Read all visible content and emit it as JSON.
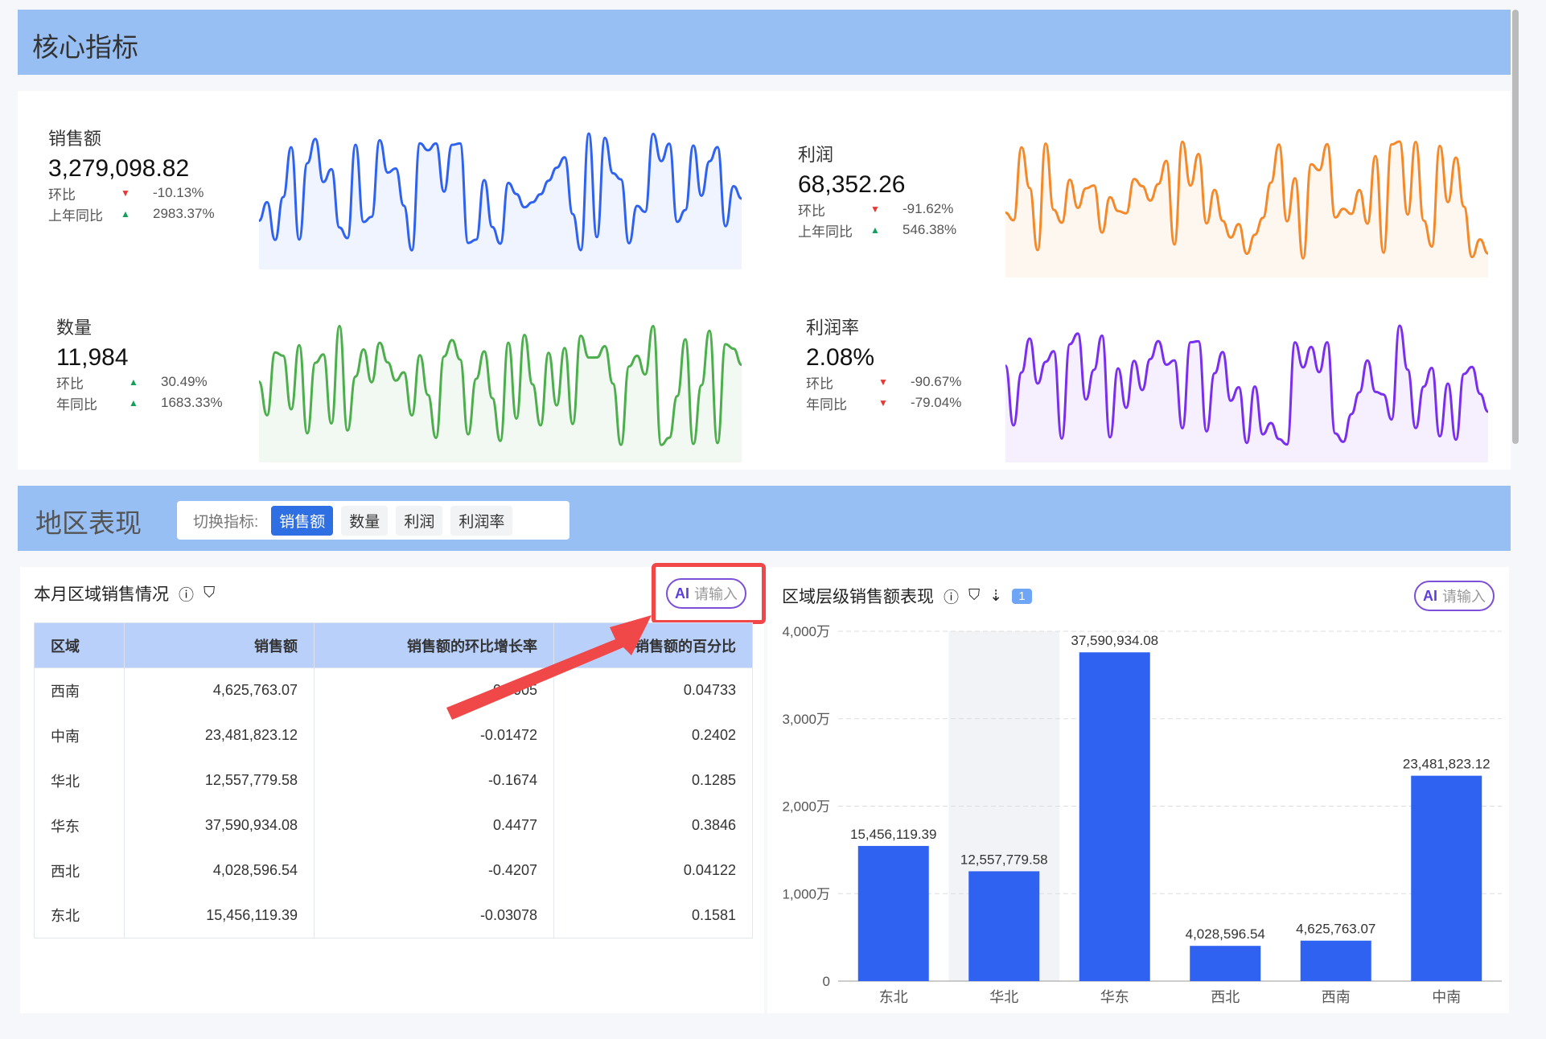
{
  "section1": {
    "title": "核心指标"
  },
  "kpis": [
    {
      "label": "销售额",
      "value": "3,279,098.82",
      "rows": [
        {
          "k": "环比",
          "dir": "down",
          "v": "-10.13%"
        },
        {
          "k": "上年同比",
          "dir": "up",
          "v": "2983.37%"
        }
      ],
      "color": "#2f62f0"
    },
    {
      "label": "利润",
      "value": "68,352.26",
      "rows": [
        {
          "k": "环比",
          "dir": "down",
          "v": "-91.62%"
        },
        {
          "k": "上年同比",
          "dir": "up",
          "v": "546.38%"
        }
      ],
      "color": "#f5892a"
    },
    {
      "label": "数量",
      "value": "11,984",
      "rows": [
        {
          "k": "环比",
          "dir": "up",
          "v": "30.49%"
        },
        {
          "k": "年同比",
          "dir": "up",
          "v": "1683.33%"
        }
      ],
      "color": "#4cae4c"
    },
    {
      "label": "利润率",
      "value": "2.08%",
      "rows": [
        {
          "k": "环比",
          "dir": "down",
          "v": "-90.67%"
        },
        {
          "k": "年同比",
          "dir": "down",
          "v": "-79.04%"
        }
      ],
      "color": "#7a2ff0"
    }
  ],
  "section2": {
    "title": "地区表现",
    "switch_label": "切换指标:",
    "options": [
      "销售额",
      "数量",
      "利润",
      "利润率"
    ],
    "selected": "销售额"
  },
  "table_panel": {
    "title": "本月区域销售情况",
    "ai_label": "AI",
    "ai_placeholder": "请输入",
    "columns": [
      "区域",
      "销售额",
      "销售额的环比增长率",
      "销售额的百分比"
    ],
    "rows": [
      [
        "西南",
        "4,625,763.07",
        "0.7005",
        "0.04733"
      ],
      [
        "中南",
        "23,481,823.12",
        "-0.01472",
        "0.2402"
      ],
      [
        "华北",
        "12,557,779.58",
        "-0.1674",
        "0.1285"
      ],
      [
        "华东",
        "37,590,934.08",
        "0.4477",
        "0.3846"
      ],
      [
        "西北",
        "4,028,596.54",
        "-0.4207",
        "0.04122"
      ],
      [
        "东北",
        "15,456,119.39",
        "-0.03078",
        "0.1581"
      ]
    ]
  },
  "chart_panel": {
    "title": "区域层级销售额表现",
    "badge": "1",
    "ai_label": "AI",
    "ai_placeholder": "请输入"
  },
  "chart_data": {
    "type": "bar",
    "categories": [
      "东北",
      "华北",
      "华东",
      "西北",
      "西南",
      "中南"
    ],
    "values": [
      15456119.39,
      12557779.58,
      37590934.08,
      4028596.54,
      4625763.07,
      23481823.12
    ],
    "labels": [
      "15,456,119.39",
      "12,557,779.58",
      "37,590,934.08",
      "4,028,596.54",
      "4,625,763.07",
      "23,481,823.12"
    ],
    "yticks": [
      "0",
      "1,000万",
      "2,000万",
      "3,000万",
      "4,000万"
    ],
    "ylim": [
      0,
      40000000
    ],
    "grid": true,
    "highlighted": "华北",
    "color": "#2f62f0"
  }
}
